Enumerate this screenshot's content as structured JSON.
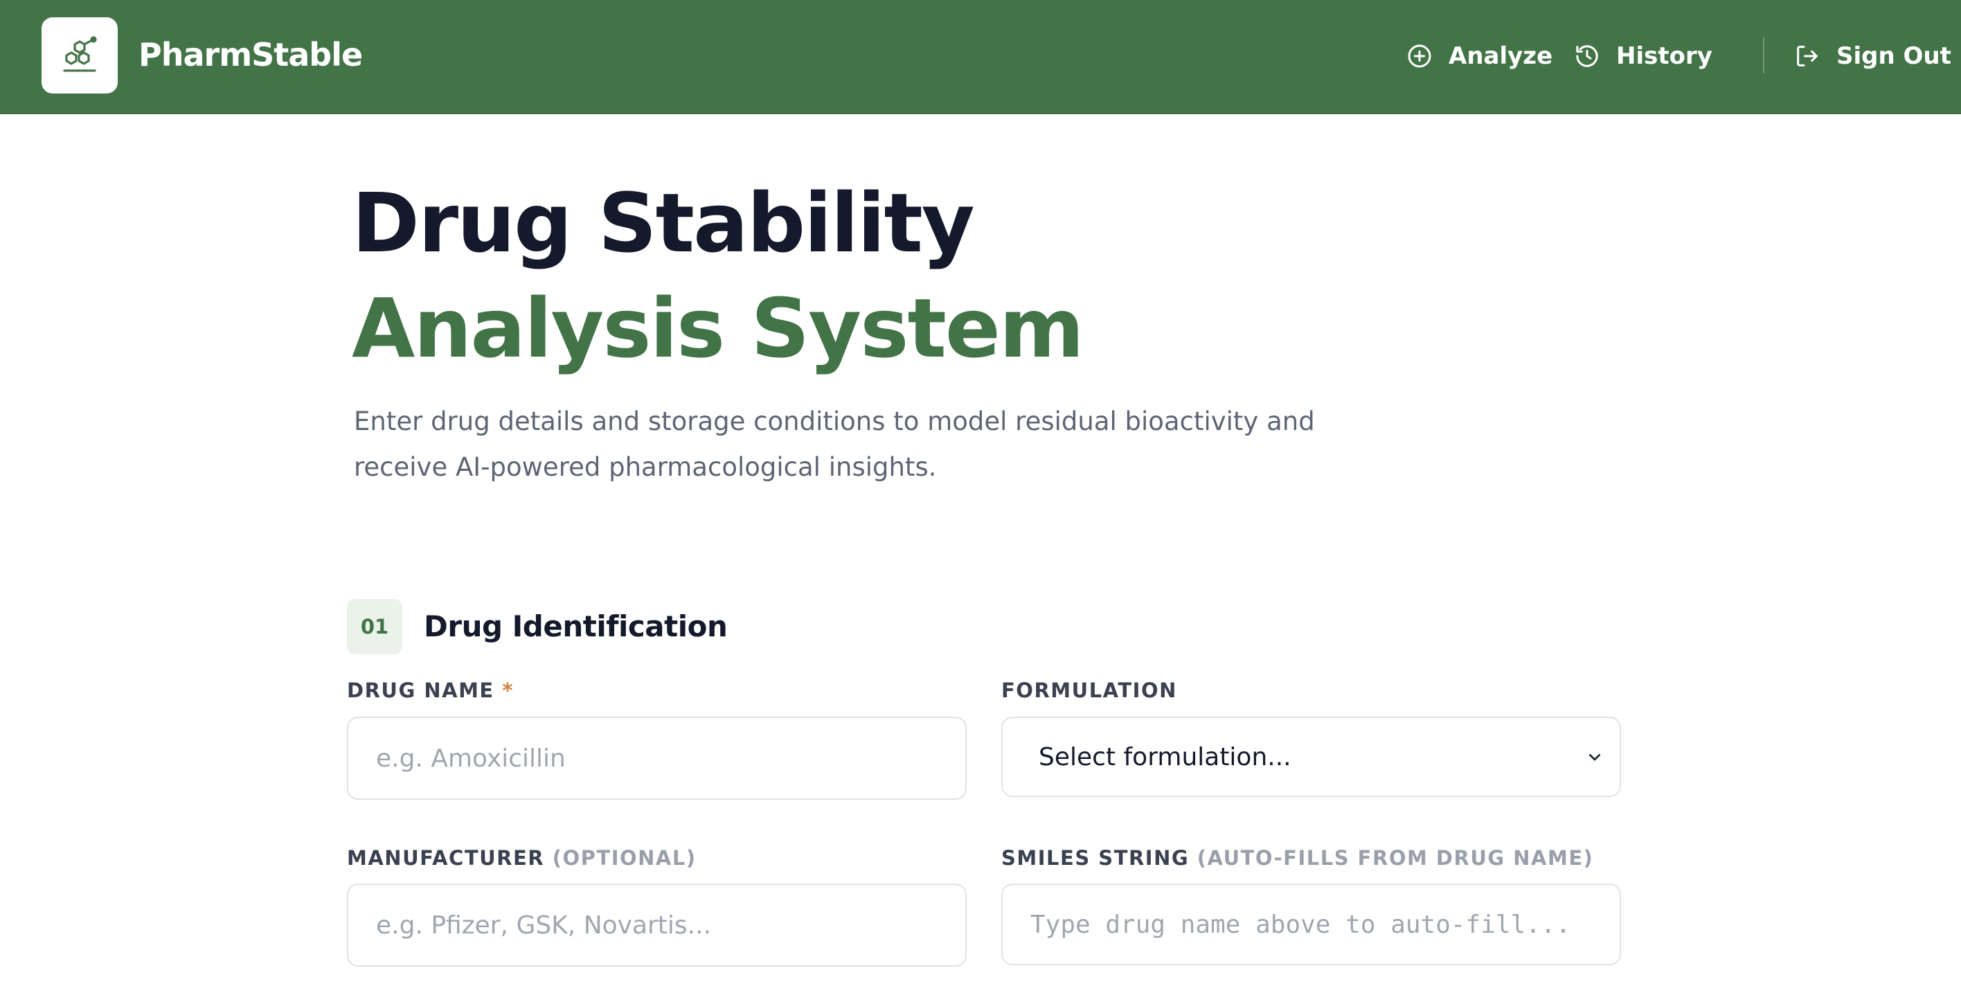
{
  "app": {
    "brand_name": "PharmStable",
    "logo_icon": "molecule-icon"
  },
  "nav": {
    "analyze": {
      "label": "Analyze",
      "icon": "plus-circle-icon"
    },
    "history": {
      "label": "History",
      "icon": "history-icon"
    },
    "sign_out": {
      "label": "Sign Out",
      "icon": "sign-out-icon"
    }
  },
  "hero": {
    "title_line1": "Drug Stability",
    "title_line2": "Analysis System",
    "subtitle": "Enter drug details and storage conditions to model residual bioactivity and receive AI-powered pharmacological insights."
  },
  "section": {
    "number": "01",
    "title": "Drug Identification"
  },
  "fields": {
    "drug_name": {
      "label": "DRUG NAME",
      "required_mark": "*",
      "placeholder": "e.g. Amoxicillin"
    },
    "formulation": {
      "label": "FORMULATION",
      "selected": "Select formulation..."
    },
    "manufacturer": {
      "label": "MANUFACTURER",
      "hint": "(OPTIONAL)",
      "placeholder": "e.g. Pfizer, GSK, Novartis..."
    },
    "smiles": {
      "label": "SMILES STRING",
      "hint": "(AUTO-FILLS FROM DRUG NAME)",
      "placeholder": "Type drug name above to auto-fill..."
    }
  },
  "colors": {
    "brand_green": "#437447",
    "heading_dark": "#141a2b",
    "required_accent": "#d3813a"
  }
}
